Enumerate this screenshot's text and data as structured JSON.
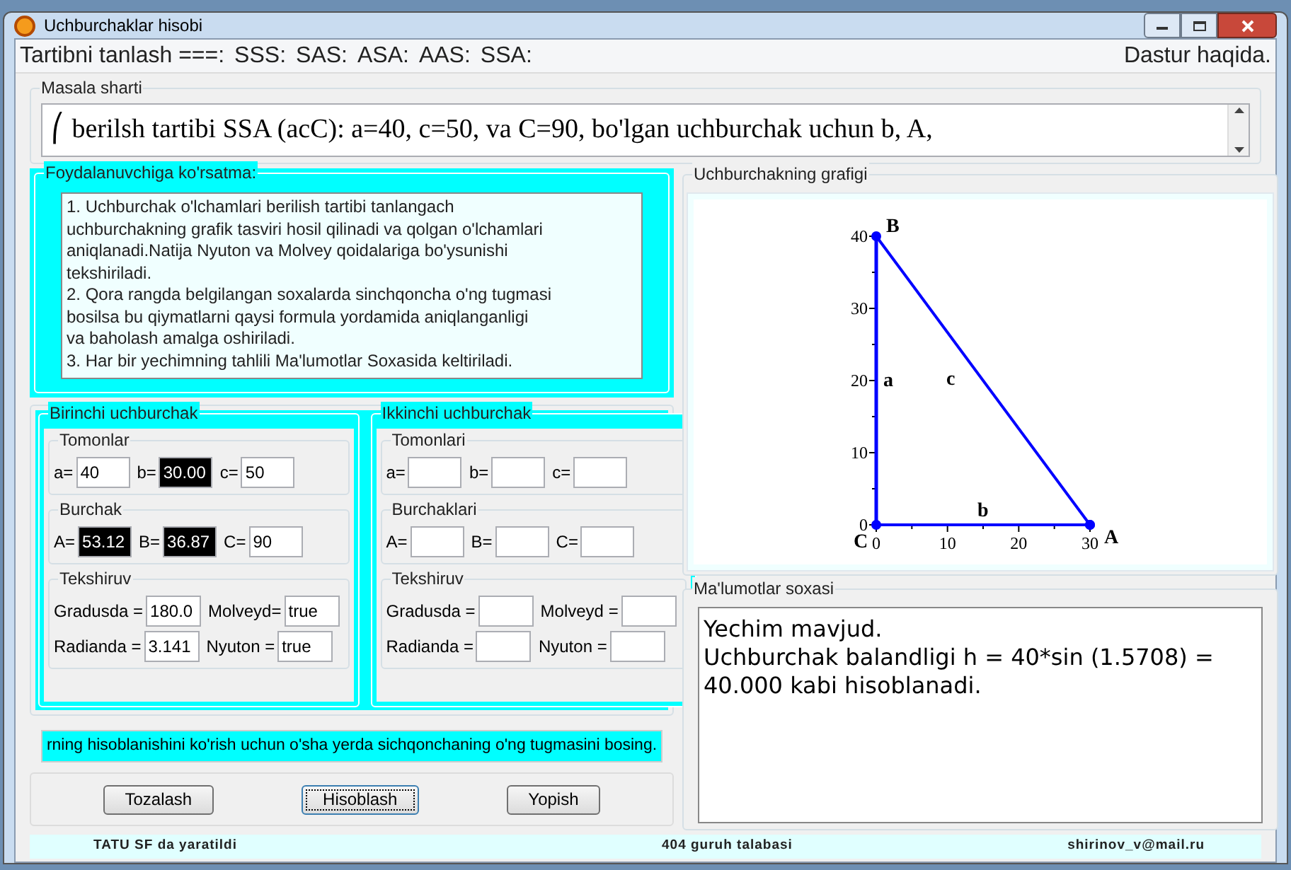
{
  "window": {
    "title": "Uchburchaklar hisobi"
  },
  "menu": {
    "items": [
      "Tartibni tanlash ===:",
      "SSS:",
      "SAS:",
      "ASA:",
      "AAS:",
      "SSA:"
    ],
    "about": "Dastur haqida."
  },
  "problem": {
    "title": "Masala sharti",
    "text": "⎛ berilsh tartibi SSA (acC): a=40, c=50, va C=90, bo'lgan uchburchak uchun  b, A,"
  },
  "instructions": {
    "title": "Foydalanuvchiga ko'rsatma:",
    "lines": [
      "1. Uchburchak o'lchamlari berilish tartibi tanlangach",
      "uchburchakning grafik tasviri hosil qilinadi va qolgan o'lchamlari",
      "aniqlanadi.Natija Nyuton va Molvey qoidalariga bo'ysunishi",
      "tekshiriladi.",
      "2. Qora rangda belgilangan soxalarda sinchqoncha o'ng tugmasi",
      "bosilsa bu qiymatlarni qaysi formula yordamida aniqlanganligi",
      "va baholash amalga oshiriladi.",
      "3. Har bir yechimning tahlili Ma'lumotlar Soxasida keltiriladi."
    ]
  },
  "triangles": [
    {
      "title": "Birinchi uchburchak",
      "groups": [
        {
          "title": "Tomonlar",
          "rows": [
            [
              {
                "label": "a=",
                "value": "40",
                "dark": false
              },
              {
                "label": "b=",
                "value": "30.00",
                "dark": true
              },
              {
                "label": "c=",
                "value": "50",
                "dark": false
              }
            ]
          ]
        },
        {
          "title": "Burchak",
          "rows": [
            [
              {
                "label": "A=",
                "value": "53.12",
                "dark": true
              },
              {
                "label": "B=",
                "value": "36.87",
                "dark": true
              },
              {
                "label": "C=",
                "value": "90",
                "dark": false
              }
            ]
          ]
        },
        {
          "title": "Tekshiruv",
          "rows": [
            [
              {
                "label": "Gradusda =",
                "value": "180.0",
                "dark": false
              },
              {
                "label": "Molveyd=",
                "value": "true",
                "dark": false
              }
            ],
            [
              {
                "label": "Radianda =",
                "value": "3.141",
                "dark": false
              },
              {
                "label": "Nyuton =",
                "value": "true",
                "dark": false
              }
            ]
          ]
        }
      ]
    },
    {
      "title": "Ikkinchi uchburchak",
      "groups": [
        {
          "title": "Tomonlari",
          "rows": [
            [
              {
                "label": "a=",
                "dark": false
              },
              {
                "label": "b=",
                "dark": false
              },
              {
                "label": "c=",
                "dark": false
              }
            ]
          ]
        },
        {
          "title": "Burchaklari",
          "rows": [
            [
              {
                "label": "A=",
                "dark": false
              },
              {
                "label": "B=",
                "dark": false
              },
              {
                "label": "C=",
                "dark": false
              }
            ]
          ]
        },
        {
          "title": "Tekshiruv",
          "rows": [
            [
              {
                "label": "Gradusda =",
                "dark": false
              },
              {
                "label": "Molveyd =",
                "dark": false
              }
            ],
            [
              {
                "label": "Radianda =",
                "dark": false
              },
              {
                "label": "Nyuton =",
                "dark": false
              }
            ]
          ]
        }
      ]
    }
  ],
  "hint": "rning hisoblanishini ko'rish uchun o'sha yerda sichqonchaning o'ng tugmasini bosing.",
  "buttons": [
    {
      "label": "Tozalash",
      "focused": false
    },
    {
      "label": "Hisoblash",
      "focused": true
    },
    {
      "label": "Yopish",
      "focused": false
    }
  ],
  "graph": {
    "title": "Uchburchakning grafigi",
    "chart_data": {
      "type": "line",
      "x": [
        0,
        30
      ],
      "series": [
        {
          "name": "c",
          "color": "#0000ff",
          "marker": "o",
          "values": [
            40,
            0
          ]
        },
        {
          "name": "b",
          "color": "#0000ff",
          "marker": "o",
          "values": [
            0,
            0
          ]
        }
      ],
      "ref_lines": [
        {
          "axis": "x",
          "value": 0,
          "label": "a",
          "color": "#0000ff"
        }
      ],
      "xlim": [
        0,
        30
      ],
      "ylim": [
        0,
        40
      ],
      "xticks": [
        0,
        10,
        20,
        30
      ],
      "yticks": [
        0,
        10,
        20,
        30,
        40
      ],
      "annotations": [
        "B",
        "C",
        "A"
      ]
    }
  },
  "info": {
    "title": "Ma'lumotlar soxasi",
    "lines": [
      "Yechim mavjud.",
      "Uchburchak balandligi h =  40*sin (1.5708) =",
      "40.000 kabi hisoblanadi."
    ]
  },
  "status_bar": [
    "TATU SF da yaratildi",
    "404 guruh talabasi",
    "shirinov_v@mail.ru"
  ]
}
